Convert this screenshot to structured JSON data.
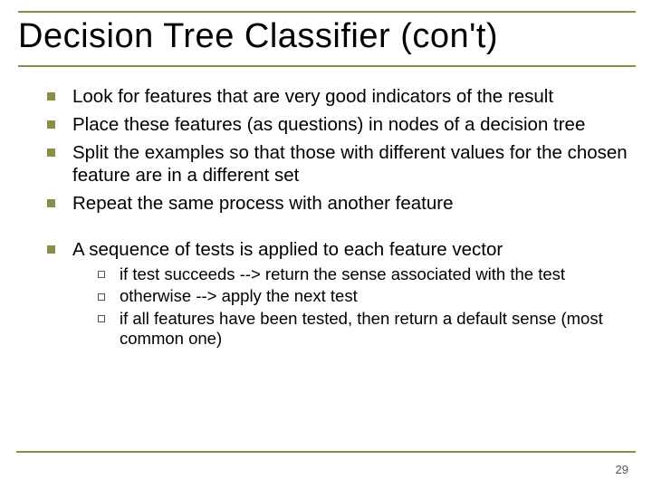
{
  "title": "Decision Tree Classifier (con't)",
  "bullets_group1": [
    "Look for features that are very good indicators of the result",
    "Place these features (as questions) in nodes of a decision tree",
    "Split the examples so that those with different values for the chosen feature are in a different set",
    "Repeat the same process with another feature"
  ],
  "bullets_group2_lead": "A sequence of tests is applied to each feature vector",
  "bullets_group2_sub": [
    "if test succeeds --> return the sense associated with the test",
    "otherwise --> apply the next test",
    "if all features have been tested, then return a default sense (most common one)"
  ],
  "page_number": "29"
}
